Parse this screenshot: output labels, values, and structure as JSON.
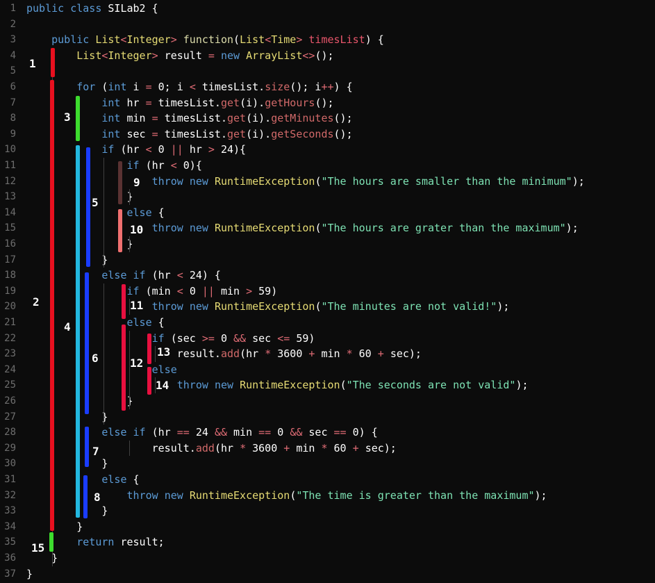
{
  "lines": [
    {
      "n": "1",
      "tokens": [
        [
          "kw",
          "public "
        ],
        [
          "kw",
          "class "
        ],
        [
          "plain",
          "SILab2 {"
        ]
      ]
    },
    {
      "n": "2",
      "tokens": []
    },
    {
      "n": "3",
      "tokens": [
        [
          "plain",
          "    "
        ],
        [
          "kw",
          "public "
        ],
        [
          "type",
          "List"
        ],
        [
          "op",
          "<"
        ],
        [
          "type",
          "Integer"
        ],
        [
          "op",
          "> "
        ],
        [
          "fn",
          "function"
        ],
        [
          "plain",
          "("
        ],
        [
          "type",
          "List"
        ],
        [
          "op",
          "<"
        ],
        [
          "type",
          "Time"
        ],
        [
          "op",
          "> "
        ],
        [
          "param",
          "timesList"
        ],
        [
          "plain",
          ") {"
        ]
      ]
    },
    {
      "n": "4",
      "tokens": [
        [
          "plain",
          "        "
        ],
        [
          "type",
          "List"
        ],
        [
          "op",
          "<"
        ],
        [
          "type",
          "Integer"
        ],
        [
          "op",
          "> "
        ],
        [
          "plain",
          "result "
        ],
        [
          "op",
          "= "
        ],
        [
          "kw",
          "new "
        ],
        [
          "type",
          "ArrayList"
        ],
        [
          "op",
          "<>"
        ],
        [
          "plain",
          "();"
        ]
      ]
    },
    {
      "n": "5",
      "tokens": []
    },
    {
      "n": "6",
      "tokens": [
        [
          "plain",
          "        "
        ],
        [
          "kw",
          "for "
        ],
        [
          "plain",
          "("
        ],
        [
          "kw",
          "int "
        ],
        [
          "plain",
          "i "
        ],
        [
          "op",
          "= "
        ],
        [
          "plain",
          "0; i "
        ],
        [
          "op",
          "< "
        ],
        [
          "plain",
          "timesList."
        ],
        [
          "method",
          "size"
        ],
        [
          "plain",
          "(); i"
        ],
        [
          "op",
          "++"
        ],
        [
          "plain",
          ") {"
        ]
      ]
    },
    {
      "n": "7",
      "tokens": [
        [
          "plain",
          "            "
        ],
        [
          "kw",
          "int "
        ],
        [
          "plain",
          "hr "
        ],
        [
          "op",
          "= "
        ],
        [
          "plain",
          "timesList."
        ],
        [
          "method",
          "get"
        ],
        [
          "plain",
          "(i)."
        ],
        [
          "method",
          "getHours"
        ],
        [
          "plain",
          "();"
        ]
      ]
    },
    {
      "n": "8",
      "tokens": [
        [
          "plain",
          "            "
        ],
        [
          "kw",
          "int "
        ],
        [
          "plain",
          "min "
        ],
        [
          "op",
          "= "
        ],
        [
          "plain",
          "timesList."
        ],
        [
          "method",
          "get"
        ],
        [
          "plain",
          "(i)."
        ],
        [
          "method",
          "getMinutes"
        ],
        [
          "plain",
          "();"
        ]
      ]
    },
    {
      "n": "9",
      "tokens": [
        [
          "plain",
          "            "
        ],
        [
          "kw",
          "int "
        ],
        [
          "plain",
          "sec "
        ],
        [
          "op",
          "= "
        ],
        [
          "plain",
          "timesList."
        ],
        [
          "method",
          "get"
        ],
        [
          "plain",
          "(i)."
        ],
        [
          "method",
          "getSeconds"
        ],
        [
          "plain",
          "();"
        ]
      ]
    },
    {
      "n": "10",
      "tokens": [
        [
          "plain",
          "            "
        ],
        [
          "kw",
          "if "
        ],
        [
          "plain",
          "(hr "
        ],
        [
          "op",
          "< "
        ],
        [
          "plain",
          "0 "
        ],
        [
          "op",
          "|| "
        ],
        [
          "plain",
          "hr "
        ],
        [
          "op",
          "> "
        ],
        [
          "plain",
          "24){"
        ]
      ]
    },
    {
      "n": "11",
      "tokens": [
        [
          "plain",
          "                "
        ],
        [
          "kw",
          "if "
        ],
        [
          "plain",
          "(hr "
        ],
        [
          "op",
          "< "
        ],
        [
          "plain",
          "0){"
        ]
      ]
    },
    {
      "n": "12",
      "tokens": [
        [
          "plain",
          "                    "
        ],
        [
          "kw",
          "throw "
        ],
        [
          "kw",
          "new "
        ],
        [
          "type",
          "RuntimeException"
        ],
        [
          "plain",
          "("
        ],
        [
          "str",
          "\"The hours are smaller than the minimum\""
        ],
        [
          "plain",
          ");"
        ]
      ]
    },
    {
      "n": "13",
      "tokens": [
        [
          "plain",
          "                }"
        ]
      ]
    },
    {
      "n": "14",
      "tokens": [
        [
          "plain",
          "                "
        ],
        [
          "kw",
          "else "
        ],
        [
          "plain",
          "{"
        ]
      ]
    },
    {
      "n": "15",
      "tokens": [
        [
          "plain",
          "                    "
        ],
        [
          "kw",
          "throw "
        ],
        [
          "kw",
          "new "
        ],
        [
          "type",
          "RuntimeException"
        ],
        [
          "plain",
          "("
        ],
        [
          "str",
          "\"The hours are grater than the maximum\""
        ],
        [
          "plain",
          ");"
        ]
      ]
    },
    {
      "n": "16",
      "tokens": [
        [
          "plain",
          "                }"
        ]
      ]
    },
    {
      "n": "17",
      "tokens": [
        [
          "plain",
          "            }"
        ]
      ]
    },
    {
      "n": "18",
      "tokens": [
        [
          "plain",
          "            "
        ],
        [
          "kw",
          "else if "
        ],
        [
          "plain",
          "(hr "
        ],
        [
          "op",
          "< "
        ],
        [
          "plain",
          "24) {"
        ]
      ]
    },
    {
      "n": "19",
      "tokens": [
        [
          "plain",
          "                "
        ],
        [
          "kw",
          "if "
        ],
        [
          "plain",
          "(min "
        ],
        [
          "op",
          "< "
        ],
        [
          "plain",
          "0 "
        ],
        [
          "op",
          "|| "
        ],
        [
          "plain",
          "min "
        ],
        [
          "op",
          "> "
        ],
        [
          "plain",
          "59)"
        ]
      ]
    },
    {
      "n": "20",
      "tokens": [
        [
          "plain",
          "                    "
        ],
        [
          "kw",
          "throw "
        ],
        [
          "kw",
          "new "
        ],
        [
          "type",
          "RuntimeException"
        ],
        [
          "plain",
          "("
        ],
        [
          "str",
          "\"The minutes are not valid!\""
        ],
        [
          "plain",
          ");"
        ]
      ]
    },
    {
      "n": "21",
      "tokens": [
        [
          "plain",
          "                "
        ],
        [
          "kw",
          "else "
        ],
        [
          "plain",
          "{"
        ]
      ]
    },
    {
      "n": "22",
      "tokens": [
        [
          "plain",
          "                    "
        ],
        [
          "kw",
          "if "
        ],
        [
          "plain",
          "(sec "
        ],
        [
          "op",
          ">= "
        ],
        [
          "plain",
          "0 "
        ],
        [
          "op",
          "&& "
        ],
        [
          "plain",
          "sec "
        ],
        [
          "op",
          "<= "
        ],
        [
          "plain",
          "59)"
        ]
      ]
    },
    {
      "n": "23",
      "tokens": [
        [
          "plain",
          "                        result."
        ],
        [
          "method",
          "add"
        ],
        [
          "plain",
          "(hr "
        ],
        [
          "op",
          "* "
        ],
        [
          "plain",
          "3600 "
        ],
        [
          "op",
          "+ "
        ],
        [
          "plain",
          "min "
        ],
        [
          "op",
          "* "
        ],
        [
          "plain",
          "60 "
        ],
        [
          "op",
          "+ "
        ],
        [
          "plain",
          "sec);"
        ]
      ]
    },
    {
      "n": "24",
      "tokens": [
        [
          "plain",
          "                    "
        ],
        [
          "kw",
          "else"
        ]
      ]
    },
    {
      "n": "25",
      "tokens": [
        [
          "plain",
          "                        "
        ],
        [
          "kw",
          "throw "
        ],
        [
          "kw",
          "new "
        ],
        [
          "type",
          "RuntimeException"
        ],
        [
          "plain",
          "("
        ],
        [
          "str",
          "\"The seconds are not valid\""
        ],
        [
          "plain",
          ");"
        ]
      ]
    },
    {
      "n": "26",
      "tokens": [
        [
          "plain",
          "                }"
        ]
      ]
    },
    {
      "n": "27",
      "tokens": [
        [
          "plain",
          "            }"
        ]
      ]
    },
    {
      "n": "28",
      "tokens": [
        [
          "plain",
          "            "
        ],
        [
          "kw",
          "else if "
        ],
        [
          "plain",
          "(hr "
        ],
        [
          "op",
          "== "
        ],
        [
          "plain",
          "24 "
        ],
        [
          "op",
          "&& "
        ],
        [
          "plain",
          "min "
        ],
        [
          "op",
          "== "
        ],
        [
          "plain",
          "0 "
        ],
        [
          "op",
          "&& "
        ],
        [
          "plain",
          "sec "
        ],
        [
          "op",
          "== "
        ],
        [
          "plain",
          "0) {"
        ]
      ]
    },
    {
      "n": "29",
      "tokens": [
        [
          "plain",
          "                    result."
        ],
        [
          "method",
          "add"
        ],
        [
          "plain",
          "(hr "
        ],
        [
          "op",
          "* "
        ],
        [
          "plain",
          "3600 "
        ],
        [
          "op",
          "+ "
        ],
        [
          "plain",
          "min "
        ],
        [
          "op",
          "* "
        ],
        [
          "plain",
          "60 "
        ],
        [
          "op",
          "+ "
        ],
        [
          "plain",
          "sec);"
        ]
      ]
    },
    {
      "n": "30",
      "tokens": [
        [
          "plain",
          "            }"
        ]
      ]
    },
    {
      "n": "31",
      "tokens": [
        [
          "plain",
          "            "
        ],
        [
          "kw",
          "else "
        ],
        [
          "plain",
          "{"
        ]
      ]
    },
    {
      "n": "32",
      "tokens": [
        [
          "plain",
          "                "
        ],
        [
          "kw",
          "throw "
        ],
        [
          "kw",
          "new "
        ],
        [
          "type",
          "RuntimeException"
        ],
        [
          "plain",
          "("
        ],
        [
          "str",
          "\"The time is greater than the maximum\""
        ],
        [
          "plain",
          ");"
        ]
      ]
    },
    {
      "n": "33",
      "tokens": [
        [
          "plain",
          "            }"
        ]
      ]
    },
    {
      "n": "34",
      "tokens": [
        [
          "plain",
          "        }"
        ]
      ]
    },
    {
      "n": "35",
      "tokens": [
        [
          "plain",
          "        "
        ],
        [
          "kw",
          "return "
        ],
        [
          "plain",
          "result;"
        ]
      ]
    },
    {
      "n": "36",
      "tokens": [
        [
          "plain",
          "    }"
        ]
      ]
    },
    {
      "n": "37",
      "tokens": [
        [
          "plain",
          "}"
        ]
      ]
    }
  ],
  "annotations": [
    {
      "label": "1",
      "color": "#e8101f"
    },
    {
      "label": "2",
      "color": "#e8101f"
    },
    {
      "label": "3",
      "color": "#3ddc2e"
    },
    {
      "label": "4",
      "color": "#23b8e0"
    },
    {
      "label": "5",
      "color": "#1a3cff"
    },
    {
      "label": "6",
      "color": "#1a3cff"
    },
    {
      "label": "7",
      "color": "#1a3cff"
    },
    {
      "label": "8",
      "color": "#1a3cff"
    },
    {
      "label": "9",
      "color": "#5a3232"
    },
    {
      "label": "10",
      "color": "#f07070"
    },
    {
      "label": "11",
      "color": "#e8103f"
    },
    {
      "label": "12",
      "color": "#e8103f"
    },
    {
      "label": "13",
      "color": "#e8103f"
    },
    {
      "label": "14",
      "color": "#e8103f"
    },
    {
      "label": "15",
      "color": "#3ddc2e"
    }
  ],
  "colors": {
    "background": "#0c0c0c",
    "keyword": "#5c9bd6",
    "type": "#e6db74",
    "function": "#dcdcaa",
    "method": "#d16969",
    "string": "#7ee3b4",
    "operator": "#e06c75",
    "param": "#e8566b"
  }
}
